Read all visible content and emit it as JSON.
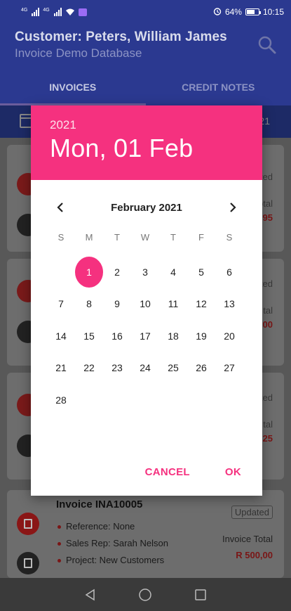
{
  "status_bar": {
    "signal1": "4G",
    "signal2": "4G",
    "battery": "64%",
    "time": "10:15"
  },
  "header": {
    "title": "Customer: Peters, William James",
    "subtitle": "Invoice Demo Database",
    "search_icon": "search-icon"
  },
  "tabs": [
    {
      "label": "INVOICES",
      "active": true
    },
    {
      "label": "CREDIT NOTES",
      "active": false
    }
  ],
  "filter": {
    "year_suffix": "21"
  },
  "background_cards": [
    {
      "badge": "ted",
      "total_label": "otal",
      "total_value": "95"
    },
    {
      "badge": "ted",
      "total_label": "tal",
      "total_value": "00"
    },
    {
      "badge": "ted",
      "total_label": "tal",
      "total_value": "25"
    }
  ],
  "invoice": {
    "title": "Invoice INA10005",
    "badge": "Updated",
    "reference": "Reference: None",
    "sales_rep": "Sales Rep: Sarah Nelson",
    "project": "Project: New Customers",
    "total_label": "Invoice Total",
    "total_value": "R 500,00"
  },
  "date_picker": {
    "year": "2021",
    "selected_date": "Mon, 01 Feb",
    "month_label": "February 2021",
    "weekdays": [
      "S",
      "M",
      "T",
      "W",
      "T",
      "F",
      "S"
    ],
    "weeks": [
      [
        "",
        "1",
        "2",
        "3",
        "4",
        "5",
        "6"
      ],
      [
        "7",
        "8",
        "9",
        "10",
        "11",
        "12",
        "13"
      ],
      [
        "14",
        "15",
        "16",
        "17",
        "18",
        "19",
        "20"
      ],
      [
        "21",
        "22",
        "23",
        "24",
        "25",
        "26",
        "27"
      ],
      [
        "28",
        "",
        "",
        "",
        "",
        "",
        ""
      ]
    ],
    "selected_day": "1",
    "cancel_label": "CANCEL",
    "ok_label": "OK"
  },
  "colors": {
    "accent": "#f5317f",
    "appbar": "#2b3990"
  }
}
